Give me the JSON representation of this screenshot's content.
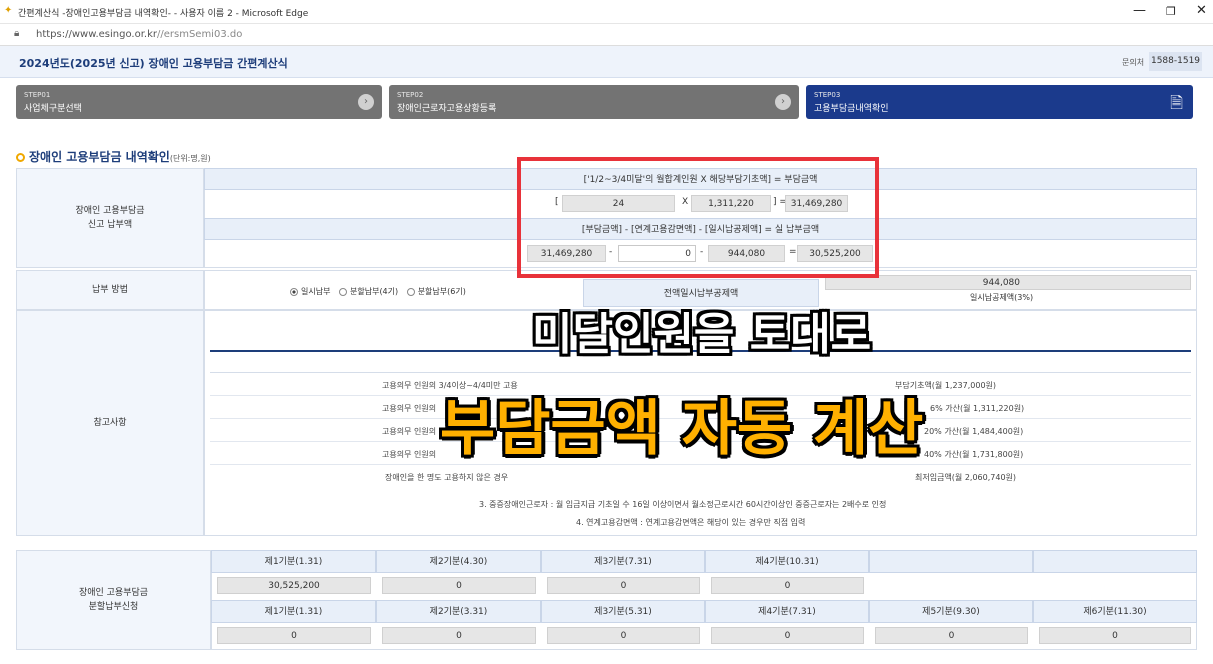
{
  "browser": {
    "title": "간편계산식 -장애인고용부담금 내역확인- - 사용자 이름 2 - Microsoft Edge",
    "url_domain": "https://www.esingo.or.kr",
    "url_path": "//ersmSemi03.do",
    "min_icon": "minimize-icon",
    "max_icon": "restore-icon",
    "close_icon": "close-icon"
  },
  "header": {
    "title": "2024년도(2025년 신고) 장애인 고용부담금 간편계산식",
    "inquiry_label": "문의처",
    "phone": "1588-1519"
  },
  "steps": [
    {
      "num": "STEP01",
      "label": "사업체구분선택"
    },
    {
      "num": "STEP02",
      "label": "장애인근로자고용상황등록"
    },
    {
      "num": "STEP03",
      "label": "고용부담금내역확인"
    }
  ],
  "section": {
    "title": "장애인 고용부담금 내역확인",
    "unit": "(단위:명,원)"
  },
  "report": {
    "label_line1": "장애인 고용부담금",
    "label_line2": "신고 납부액",
    "formula1": "['1/2~3/4미달'의 월합계인원 X 해당부담기초액] = 부담금액",
    "bracket_open": "[",
    "headcount": "24",
    "times": "X",
    "base_amount": "1,311,220",
    "bracket_close_eq": "] =",
    "burden": "31,469,280",
    "formula2": "[부담금액] - [연계고용감면액] - [일시납공제액] = 실 납부금액",
    "v_burden": "31,469,280",
    "minus1": "-",
    "v_linked": "0",
    "minus2": "-",
    "v_lump": "944,080",
    "eq": "=",
    "v_actual": "30,525,200"
  },
  "payment": {
    "label": "납부 방법",
    "opt1": "일시납부",
    "opt2": "분할납부(4기)",
    "opt3": "분할납부(6기)",
    "lump_header": "전액일시납부공제액",
    "lump_value": "944,080",
    "lump_note": "일시납공제액(3%)"
  },
  "notes": {
    "label": "참고사항",
    "rows": [
      {
        "left": "고용의무 인원의 3/4이상~4/4미만 고용",
        "right": "부담기초액(월 1,237,000원)"
      },
      {
        "left": "고용의무 인원의",
        "right": "6% 가산(월 1,311,220원)"
      },
      {
        "left": "고용의무 인원의",
        "right": "20% 가산(월 1,484,400원)"
      },
      {
        "left": "고용의무 인원의",
        "right": "40% 가산(월 1,731,800원)"
      },
      {
        "left": "장애인을 한 명도 고용하지 않은 경우",
        "right": "최저임금액(월 2,060,740원)"
      }
    ],
    "note3": "3. 중증장애인근로자 : 월 임금지급 기초일 수 16일 이상이면서 월소정근로시간 60시간이상인 중증근로자는 2배수로 인정",
    "note4": "4. 연계고용감면액 : 연계고용감면액은 해당이 있는 경우만 직접 입력"
  },
  "installments": {
    "label_line1": "장애인 고용부담금",
    "label_line2": "분할납부신청",
    "q4": [
      {
        "head": "제1기분(1.31)",
        "value": "30,525,200"
      },
      {
        "head": "제2기분(4.30)",
        "value": "0"
      },
      {
        "head": "제3기분(7.31)",
        "value": "0"
      },
      {
        "head": "제4기분(10.31)",
        "value": "0"
      }
    ],
    "q6": [
      {
        "head": "제1기분(1.31)",
        "value": "0"
      },
      {
        "head": "제2기분(3.31)",
        "value": "0"
      },
      {
        "head": "제3기분(5.31)",
        "value": "0"
      },
      {
        "head": "제4기분(7.31)",
        "value": "0"
      },
      {
        "head": "제5기분(9.30)",
        "value": "0"
      },
      {
        "head": "제6기분(11.30)",
        "value": "0"
      }
    ]
  },
  "overlay": {
    "line1": "미달인원을 토대로",
    "line2": "부담금액 자동 계산"
  },
  "colors": {
    "accent": "#1d3d7a",
    "step_active": "#1b3a8c",
    "step_inactive": "#707070",
    "highlight_box": "#e8323a",
    "overlay_text": "#ffb000"
  }
}
